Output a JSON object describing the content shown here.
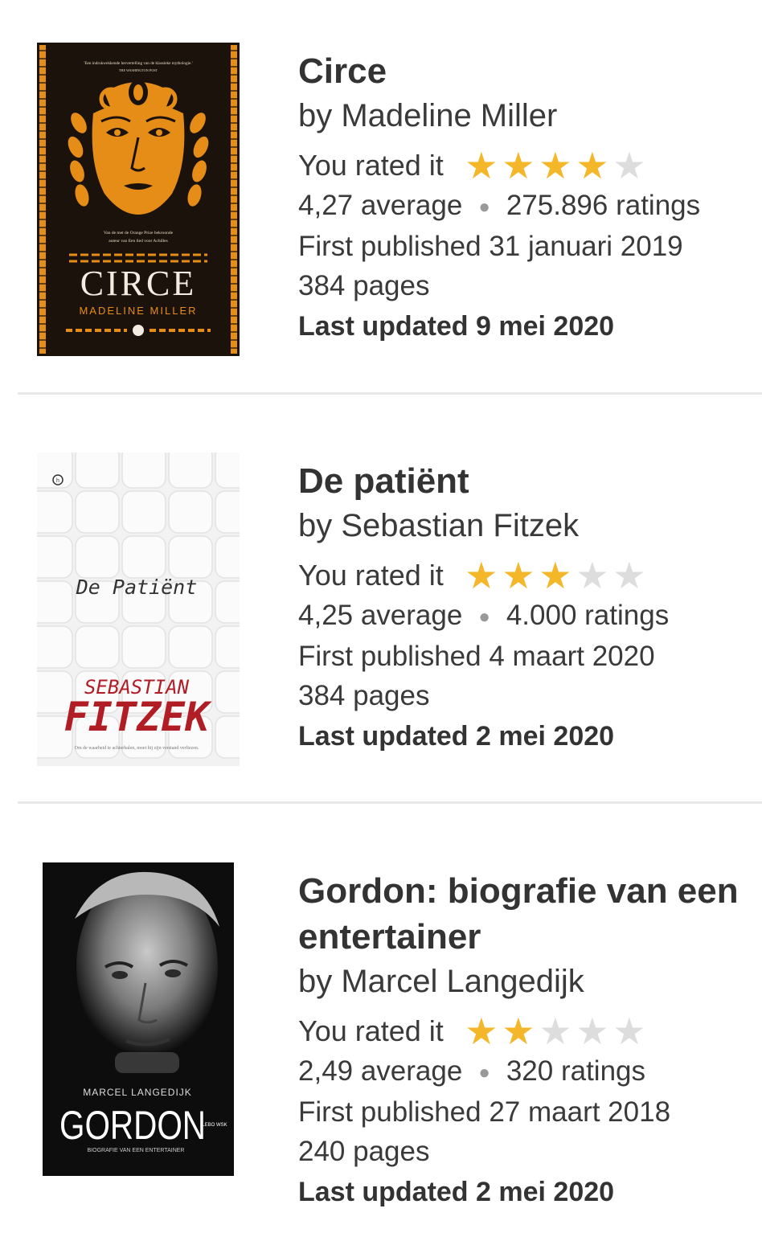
{
  "books": [
    {
      "title": "Circe",
      "author": "by Madeline Miller",
      "rated_label": "You rated it",
      "user_rating": 4,
      "average": "4,27 average",
      "ratings": "275.896 ratings",
      "published": "First published 31 januari 2019",
      "pages": "384 pages",
      "updated": "Last updated 9 mei 2020",
      "cover": {
        "quote": "'Een indrukwekkende hervertelling van de klassieke mythologie.'",
        "quote_source": "THE WASHINGTON POST",
        "blurb_1": "Van de met de Orange Prize bekroonde",
        "blurb_2": "auteur van Een lied voor Achilles",
        "title": "CIRCE",
        "author": "MADELINE MILLER"
      }
    },
    {
      "title": "De patiënt",
      "author": "by Sebastian Fitzek",
      "rated_label": "You rated it",
      "user_rating": 3,
      "average": "4,25 average",
      "ratings": "4.000 ratings",
      "published": "First published 4 maart 2020",
      "pages": "384 pages",
      "updated": "Last updated 2 mei 2020",
      "cover": {
        "title": "De Patiënt",
        "author_first": "SEBASTIAN",
        "author_last": "FITZEK",
        "tagline": "Om de waarheid te achterhalen, moet hij zijn verstand verliezen."
      }
    },
    {
      "title": "Gordon: biografie van een entertainer",
      "author": "by Marcel Langedijk",
      "rated_label": "You rated it",
      "user_rating": 2,
      "average": "2,49 average",
      "ratings": "320 ratings",
      "published": "First published 27 maart 2018",
      "pages": "240 pages",
      "updated": "Last updated 2 mei 2020",
      "cover": {
        "author": "MARCEL LANGEDIJK",
        "title": "GORDON",
        "subtitle": "BIOGRAFIE VAN EEN ENTERTAINER",
        "publisher": "LEBO WSK"
      }
    }
  ],
  "max_rating": 5,
  "colors": {
    "star_on": "#f4b72a",
    "star_off": "#dddddd",
    "divider": "#e8e8e8"
  }
}
